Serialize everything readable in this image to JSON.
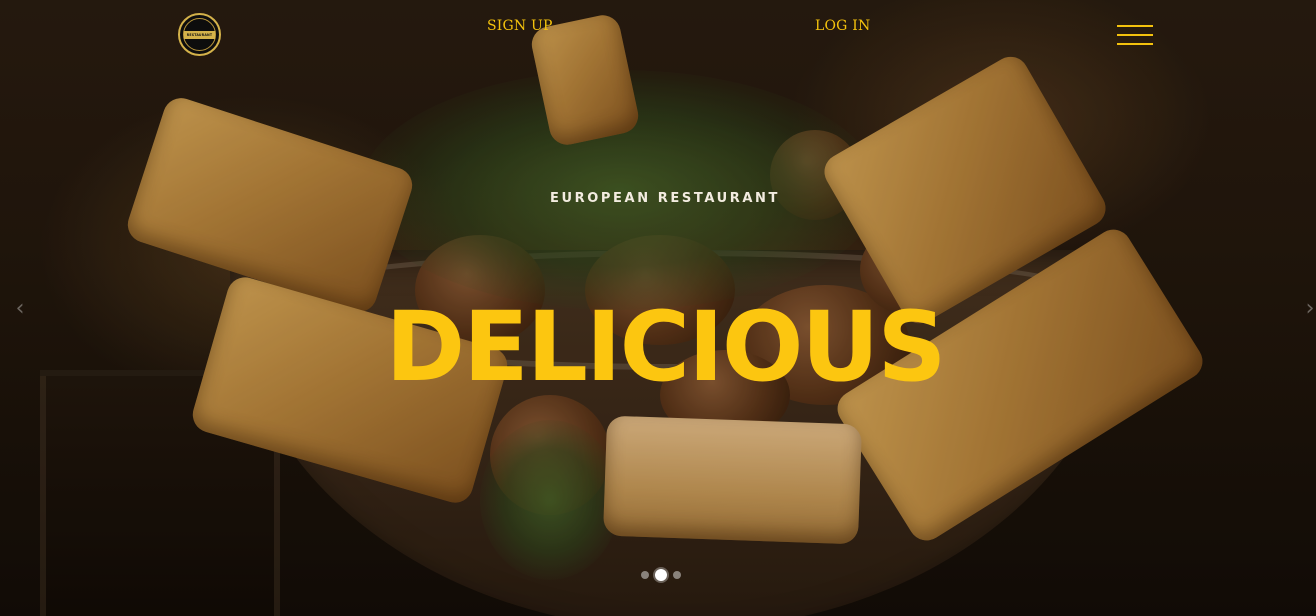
{
  "header": {
    "logo_text": "RESTAURANT",
    "nav": {
      "signup": "SIGN UP",
      "login": "LOG IN"
    },
    "menu_icon": "hamburger-icon"
  },
  "hero": {
    "subtitle": "EUROPEAN RESTAURANT",
    "headline": "DELICIOUS",
    "arrow_prev": "‹",
    "arrow_next": "›",
    "slides_total": 3,
    "active_slide": 2
  },
  "colors": {
    "accent": "#fcc610",
    "nav_text": "#f4c20d",
    "subtitle_text": "#f3ece0"
  }
}
